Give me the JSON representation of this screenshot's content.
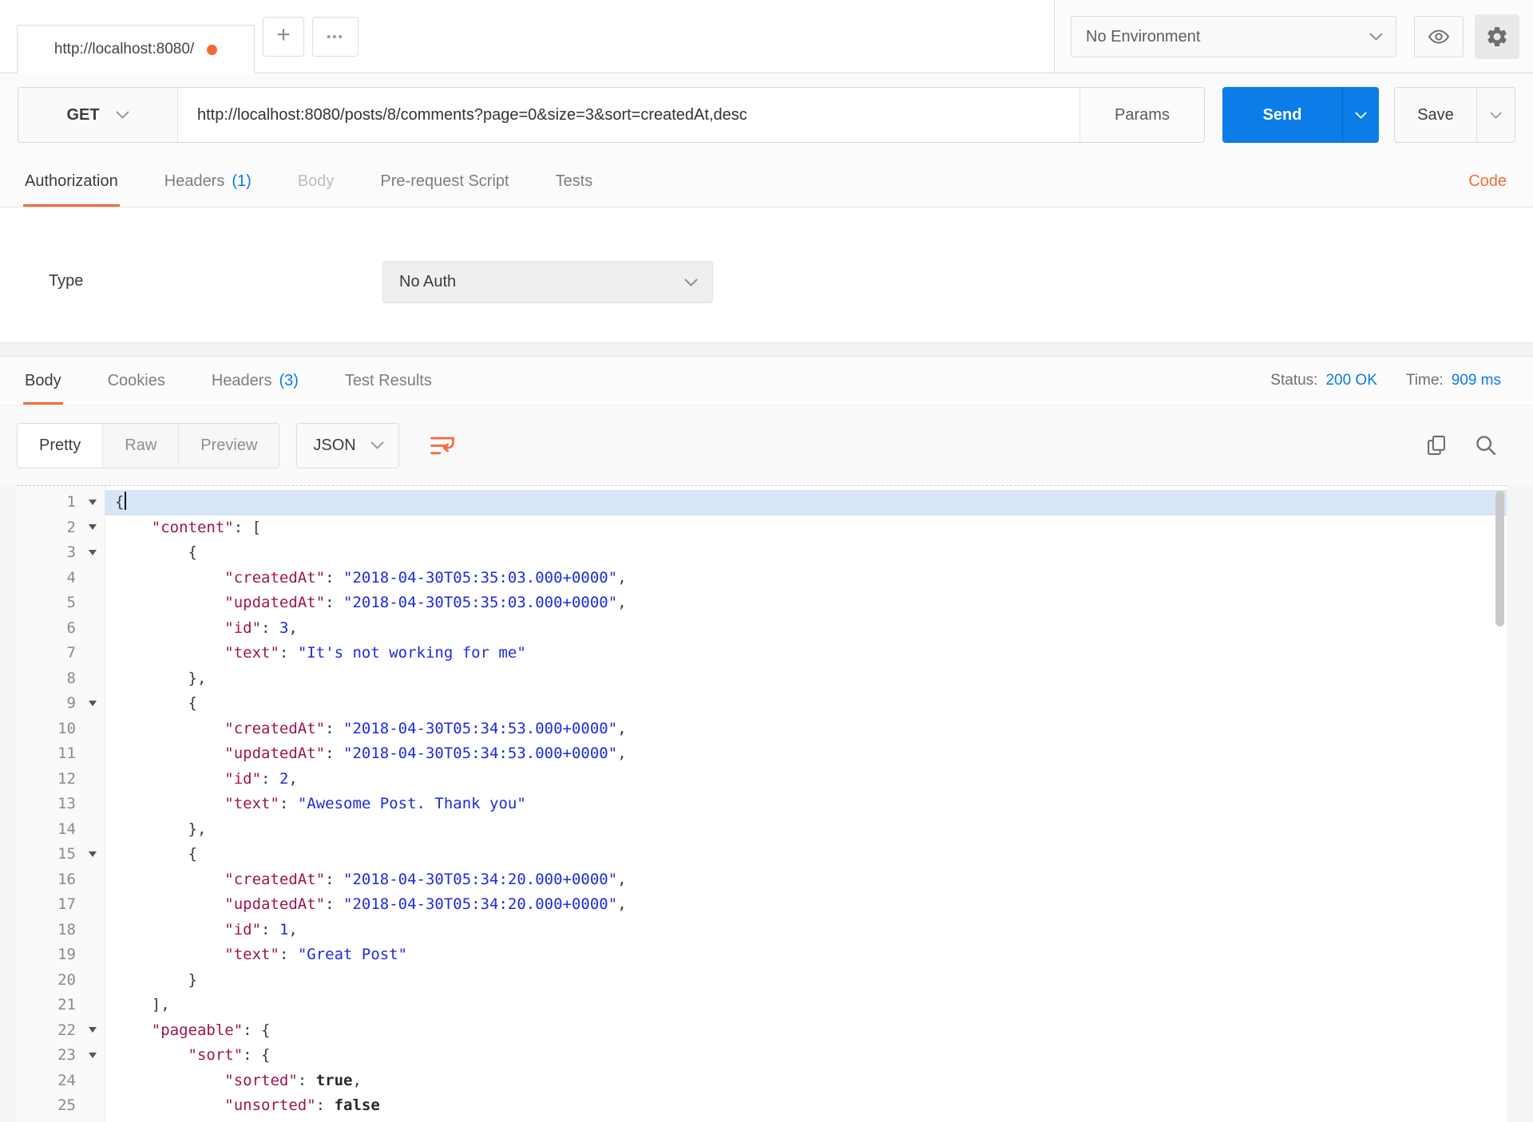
{
  "topbar": {
    "tab_title": "http://localhost:8080/",
    "new_tab_label": "+",
    "more_label": "•••",
    "environment": "No Environment"
  },
  "request": {
    "method": "GET",
    "url": "http://localhost:8080/posts/8/comments?page=0&size=3&sort=createdAt,desc",
    "params_label": "Params",
    "send_label": "Send",
    "save_label": "Save",
    "code_link": "Code",
    "tabs": [
      {
        "label": "Authorization",
        "active": true
      },
      {
        "label": "Headers",
        "count": "(1)"
      },
      {
        "label": "Body",
        "disabled": true
      },
      {
        "label": "Pre-request Script"
      },
      {
        "label": "Tests"
      }
    ],
    "auth": {
      "type_label": "Type",
      "type_value": "No Auth"
    }
  },
  "response": {
    "tabs": [
      {
        "label": "Body",
        "active": true
      },
      {
        "label": "Cookies"
      },
      {
        "label": "Headers",
        "count": "(3)"
      },
      {
        "label": "Test Results"
      }
    ],
    "status_label": "Status:",
    "status_value": "200 OK",
    "time_label": "Time:",
    "time_value": "909 ms",
    "view_modes": [
      "Pretty",
      "Raw",
      "Preview"
    ],
    "active_view_mode": "Pretty",
    "language": "JSON"
  },
  "colors": {
    "accent_orange": "#F26B3A",
    "link_blue": "#097BED",
    "send_button_blue": "#0B7CE8",
    "json_key": "#A0144E",
    "json_string": "#1C2BE2",
    "json_boolean": "#282828",
    "selected_line_bg": "#D7E5F6"
  },
  "editor": {
    "lines": [
      {
        "n": 1,
        "fold": true,
        "sel": true,
        "cursor": true,
        "seg": [
          [
            "p",
            "{"
          ]
        ]
      },
      {
        "n": 2,
        "fold": true,
        "seg": [
          [
            "p",
            "    "
          ],
          [
            "k",
            "\"content\""
          ],
          [
            "p",
            ": ["
          ]
        ]
      },
      {
        "n": 3,
        "fold": true,
        "seg": [
          [
            "p",
            "        {"
          ]
        ]
      },
      {
        "n": 4,
        "seg": [
          [
            "p",
            "            "
          ],
          [
            "k",
            "\"createdAt\""
          ],
          [
            "p",
            ": "
          ],
          [
            "s",
            "\"2018-04-30T05:35:03.000+0000\""
          ],
          [
            "p",
            ","
          ]
        ]
      },
      {
        "n": 5,
        "seg": [
          [
            "p",
            "            "
          ],
          [
            "k",
            "\"updatedAt\""
          ],
          [
            "p",
            ": "
          ],
          [
            "s",
            "\"2018-04-30T05:35:03.000+0000\""
          ],
          [
            "p",
            ","
          ]
        ]
      },
      {
        "n": 6,
        "seg": [
          [
            "p",
            "            "
          ],
          [
            "k",
            "\"id\""
          ],
          [
            "p",
            ": "
          ],
          [
            "num",
            "3"
          ],
          [
            "p",
            ","
          ]
        ]
      },
      {
        "n": 7,
        "seg": [
          [
            "p",
            "            "
          ],
          [
            "k",
            "\"text\""
          ],
          [
            "p",
            ": "
          ],
          [
            "s",
            "\"It's not working for me\""
          ]
        ]
      },
      {
        "n": 8,
        "seg": [
          [
            "p",
            "        },"
          ]
        ]
      },
      {
        "n": 9,
        "fold": true,
        "seg": [
          [
            "p",
            "        {"
          ]
        ]
      },
      {
        "n": 10,
        "seg": [
          [
            "p",
            "            "
          ],
          [
            "k",
            "\"createdAt\""
          ],
          [
            "p",
            ": "
          ],
          [
            "s",
            "\"2018-04-30T05:34:53.000+0000\""
          ],
          [
            "p",
            ","
          ]
        ]
      },
      {
        "n": 11,
        "seg": [
          [
            "p",
            "            "
          ],
          [
            "k",
            "\"updatedAt\""
          ],
          [
            "p",
            ": "
          ],
          [
            "s",
            "\"2018-04-30T05:34:53.000+0000\""
          ],
          [
            "p",
            ","
          ]
        ]
      },
      {
        "n": 12,
        "seg": [
          [
            "p",
            "            "
          ],
          [
            "k",
            "\"id\""
          ],
          [
            "p",
            ": "
          ],
          [
            "num",
            "2"
          ],
          [
            "p",
            ","
          ]
        ]
      },
      {
        "n": 13,
        "seg": [
          [
            "p",
            "            "
          ],
          [
            "k",
            "\"text\""
          ],
          [
            "p",
            ": "
          ],
          [
            "s",
            "\"Awesome Post. Thank you\""
          ]
        ]
      },
      {
        "n": 14,
        "seg": [
          [
            "p",
            "        },"
          ]
        ]
      },
      {
        "n": 15,
        "fold": true,
        "seg": [
          [
            "p",
            "        {"
          ]
        ]
      },
      {
        "n": 16,
        "seg": [
          [
            "p",
            "            "
          ],
          [
            "k",
            "\"createdAt\""
          ],
          [
            "p",
            ": "
          ],
          [
            "s",
            "\"2018-04-30T05:34:20.000+0000\""
          ],
          [
            "p",
            ","
          ]
        ]
      },
      {
        "n": 17,
        "seg": [
          [
            "p",
            "            "
          ],
          [
            "k",
            "\"updatedAt\""
          ],
          [
            "p",
            ": "
          ],
          [
            "s",
            "\"2018-04-30T05:34:20.000+0000\""
          ],
          [
            "p",
            ","
          ]
        ]
      },
      {
        "n": 18,
        "seg": [
          [
            "p",
            "            "
          ],
          [
            "k",
            "\"id\""
          ],
          [
            "p",
            ": "
          ],
          [
            "num",
            "1"
          ],
          [
            "p",
            ","
          ]
        ]
      },
      {
        "n": 19,
        "seg": [
          [
            "p",
            "            "
          ],
          [
            "k",
            "\"text\""
          ],
          [
            "p",
            ": "
          ],
          [
            "s",
            "\"Great Post\""
          ]
        ]
      },
      {
        "n": 20,
        "seg": [
          [
            "p",
            "        }"
          ]
        ]
      },
      {
        "n": 21,
        "seg": [
          [
            "p",
            "    ],"
          ]
        ]
      },
      {
        "n": 22,
        "fold": true,
        "seg": [
          [
            "p",
            "    "
          ],
          [
            "k",
            "\"pageable\""
          ],
          [
            "p",
            ": {"
          ]
        ]
      },
      {
        "n": 23,
        "fold": true,
        "seg": [
          [
            "p",
            "        "
          ],
          [
            "k",
            "\"sort\""
          ],
          [
            "p",
            ": {"
          ]
        ]
      },
      {
        "n": 24,
        "seg": [
          [
            "p",
            "            "
          ],
          [
            "k",
            "\"sorted\""
          ],
          [
            "p",
            ": "
          ],
          [
            "b",
            "true"
          ],
          [
            "p",
            ","
          ]
        ]
      },
      {
        "n": 25,
        "seg": [
          [
            "p",
            "            "
          ],
          [
            "k",
            "\"unsorted\""
          ],
          [
            "p",
            ": "
          ],
          [
            "b",
            "false"
          ]
        ]
      }
    ]
  }
}
